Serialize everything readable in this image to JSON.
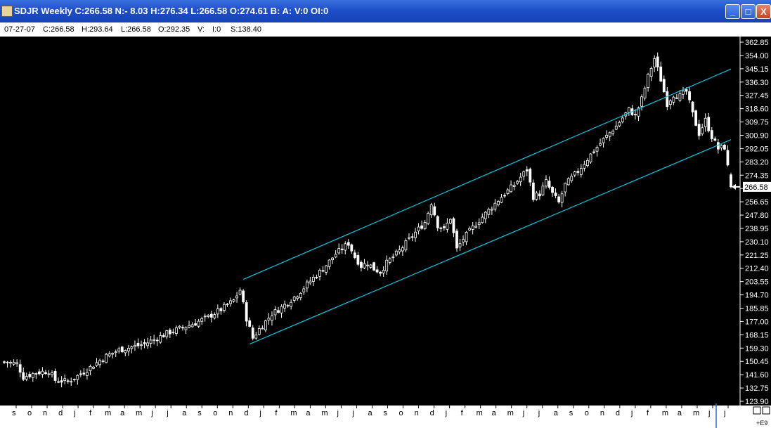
{
  "window": {
    "title": "SDJR Weekly C:266.58 N:- 8.03 H:276.34 L:266.58 O:274.61 B: A: V:0 OI:0",
    "buttons": [
      "_",
      "□",
      "X"
    ]
  },
  "info_bar": {
    "date": "07-27-07",
    "close": "C:266.58",
    "high": "H:293.64",
    "low": "L:266.58",
    "open": "O:292.35",
    "volume": "V:",
    "oi": "I:0",
    "s": "S:138.40"
  },
  "chart_data": {
    "type": "candlestick",
    "symbol": "SDJR",
    "interval": "Weekly",
    "background": "#000000",
    "candle_color": "#ffffff",
    "trendline_color": "#00c8e0",
    "grid": false,
    "ylim": [
      123.9,
      362.85
    ],
    "yticks": [
      "362.85",
      "354.00",
      "345.15",
      "336.30",
      "327.45",
      "318.60",
      "309.75",
      "300.90",
      "292.05",
      "283.20",
      "274.35",
      "265.50",
      "256.65",
      "247.80",
      "238.95",
      "230.10",
      "221.25",
      "212.40",
      "203.55",
      "194.70",
      "185.85",
      "177.00",
      "168.15",
      "159.30",
      "150.45",
      "141.60",
      "132.75",
      "123.90"
    ],
    "last_price": "266.58",
    "x_labels": [
      "s",
      "o",
      "n",
      "d",
      "j",
      "f",
      "m",
      "a",
      "m",
      "j",
      "j",
      "a",
      "s",
      "o",
      "n",
      "d",
      "j",
      "f",
      "m",
      "a",
      "m",
      "j",
      "j",
      "a",
      "s",
      "o",
      "n",
      "d",
      "j",
      "f",
      "m",
      "a",
      "m",
      "j",
      "j",
      "a",
      "s",
      "o",
      "n",
      "d",
      "j",
      "f",
      "m",
      "a",
      "m",
      "j",
      "j"
    ],
    "x_scale_note": "+E9",
    "close_path": [
      [
        0,
        150
      ],
      [
        4,
        149
      ],
      [
        6,
        140
      ],
      [
        10,
        143
      ],
      [
        14,
        144
      ],
      [
        16,
        138
      ],
      [
        20,
        137
      ],
      [
        24,
        142
      ],
      [
        28,
        148
      ],
      [
        32,
        154
      ],
      [
        36,
        158
      ],
      [
        40,
        160
      ],
      [
        44,
        162
      ],
      [
        48,
        166
      ],
      [
        52,
        170
      ],
      [
        56,
        173
      ],
      [
        60,
        176
      ],
      [
        64,
        180
      ],
      [
        68,
        185
      ],
      [
        72,
        191
      ],
      [
        74,
        198
      ],
      [
        76,
        179
      ],
      [
        78,
        166
      ],
      [
        80,
        172
      ],
      [
        84,
        182
      ],
      [
        88,
        188
      ],
      [
        92,
        195
      ],
      [
        96,
        204
      ],
      [
        100,
        212
      ],
      [
        104,
        222
      ],
      [
        108,
        229
      ],
      [
        110,
        220
      ],
      [
        112,
        214
      ],
      [
        114,
        216
      ],
      [
        116,
        212
      ],
      [
        118,
        210
      ],
      [
        120,
        216
      ],
      [
        124,
        224
      ],
      [
        128,
        234
      ],
      [
        132,
        243
      ],
      [
        134,
        256
      ],
      [
        136,
        241
      ],
      [
        138,
        238
      ],
      [
        140,
        246
      ],
      [
        142,
        225
      ],
      [
        144,
        232
      ],
      [
        148,
        242
      ],
      [
        152,
        251
      ],
      [
        156,
        260
      ],
      [
        160,
        268
      ],
      [
        164,
        278
      ],
      [
        166,
        260
      ],
      [
        168,
        262
      ],
      [
        170,
        270
      ],
      [
        172,
        262
      ],
      [
        174,
        256
      ],
      [
        176,
        268
      ],
      [
        180,
        277
      ],
      [
        184,
        288
      ],
      [
        188,
        298
      ],
      [
        192,
        307
      ],
      [
        196,
        318
      ],
      [
        198,
        314
      ],
      [
        200,
        325
      ],
      [
        202,
        340
      ],
      [
        204,
        352
      ],
      [
        206,
        338
      ],
      [
        208,
        322
      ],
      [
        210,
        328
      ],
      [
        212,
        327
      ],
      [
        214,
        330
      ],
      [
        216,
        315
      ],
      [
        218,
        302
      ],
      [
        220,
        311
      ],
      [
        222,
        300
      ],
      [
        224,
        292
      ],
      [
        226,
        293
      ],
      [
        228,
        266.58
      ]
    ],
    "x_count": 229,
    "trendlines": [
      {
        "name": "upper channel",
        "from": [
          75,
          205
        ],
        "to": [
          228,
          345
        ]
      },
      {
        "name": "lower channel",
        "from": [
          77,
          162
        ],
        "to": [
          228,
          298
        ]
      }
    ]
  }
}
